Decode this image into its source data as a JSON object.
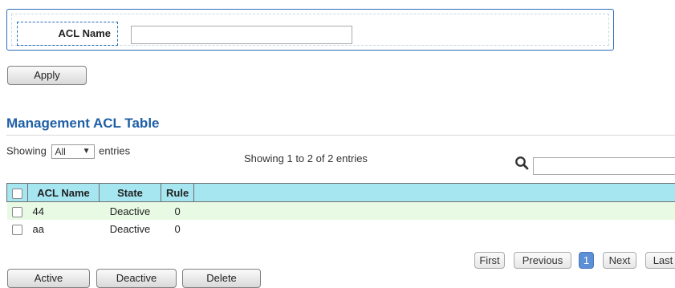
{
  "form": {
    "acl_name_label": "ACL Name",
    "acl_name_value": "",
    "apply_label": "Apply"
  },
  "section": {
    "title": "Management ACL Table"
  },
  "entries": {
    "showing_label": "Showing",
    "selected": "All",
    "entries_label": "entries",
    "info": "Showing 1 to 2 of 2 entries",
    "search_value": ""
  },
  "table": {
    "headers": [
      "ACL Name",
      "State",
      "Rule"
    ],
    "rows": [
      {
        "name": "44",
        "state": "Deactive",
        "rule": "0"
      },
      {
        "name": "aa",
        "state": "Deactive",
        "rule": "0"
      }
    ]
  },
  "pagination": {
    "first": "First",
    "previous": "Previous",
    "current": "1",
    "next": "Next",
    "last": "Last"
  },
  "actions": {
    "active": "Active",
    "deactive": "Deactive",
    "delete": "Delete"
  },
  "colors": {
    "accent": "#1f5fa6",
    "header_bg": "#a6e6f0",
    "row_highlight": "#e8fae4"
  }
}
